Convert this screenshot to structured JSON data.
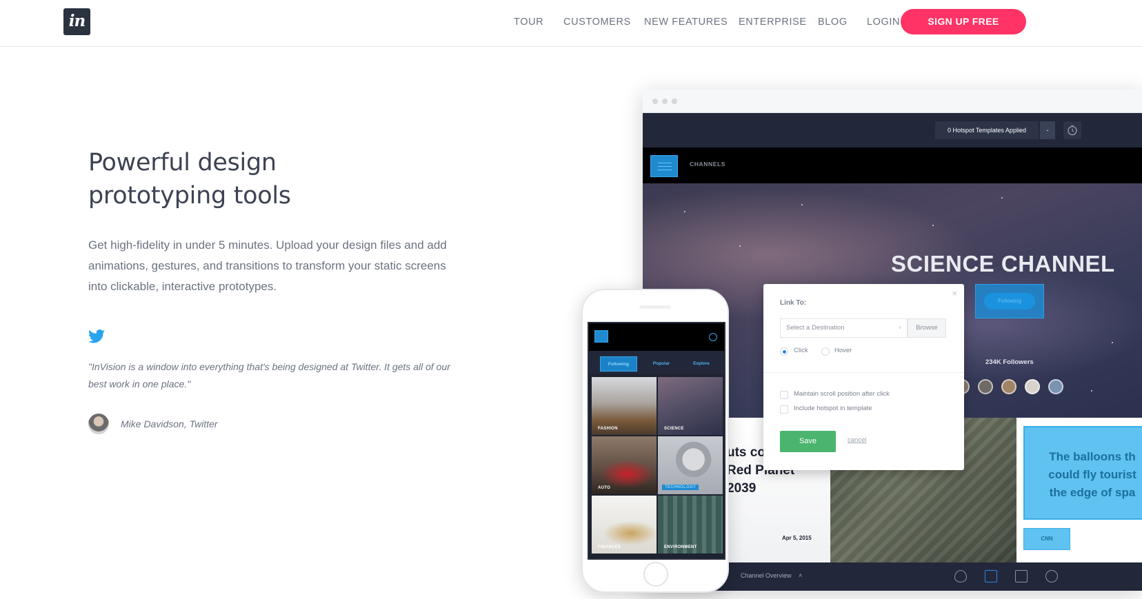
{
  "header": {
    "logo_text": "in",
    "nav": [
      "TOUR",
      "CUSTOMERS",
      "NEW FEATURES",
      "ENTERPRISE",
      "BLOG",
      "LOGIN"
    ],
    "signup_label": "SIGN UP FREE"
  },
  "hero": {
    "title_line1": "Powerful design",
    "title_line2": "prototyping tools",
    "description": "Get high-fidelity in under 5 minutes. Upload your design files and add animations, gestures, and transitions to transform your static screens into clickable, interactive prototypes.",
    "quote": "\"InVision is a window into everything that's being designed at Twitter. It gets all of our best work in one place.\"",
    "author": "Mike Davidson, Twitter"
  },
  "desktop": {
    "templates_label": "0 Hotspot Templates Applied",
    "templates_caret": "-",
    "channels_label": "CHANNELS",
    "science_title": "SCIENCE CHANNEL",
    "following_label": "Following",
    "followers_label": "234K Followers",
    "card_text": "uts co\nRed Planet\n2039",
    "card_date": "Apr 5, 2015",
    "blue_text": "The balloons th\ncould fly tourist\nthe edge of spa",
    "cnn_label": "CNN",
    "channel_overview": "Channel Overview",
    "overview_caret": "˄"
  },
  "modal": {
    "close": "×",
    "title": "Link To:",
    "destination_placeholder": "Select a Destination",
    "destination_caret": "˅",
    "browse_label": "Browse",
    "radio_click": "Click",
    "radio_hover": "Hover",
    "check_scroll": "Maintain scroll position after click",
    "check_hotspot": "Include hotspot in template",
    "save_label": "Save",
    "cancel_label": "cancel"
  },
  "phone": {
    "tabs": [
      "Following",
      "Popular",
      "Explore"
    ],
    "tiles": [
      "FASHION",
      "SCIENCE",
      "AUTO",
      "TECHNOLOGY",
      "FINANCES",
      "ENVIRONMENT"
    ]
  },
  "colors": {
    "accent": "#ff3366",
    "brand_dark": "#2b3240",
    "toolbar": "#22283a",
    "highlight_blue": "#1f8ad0",
    "save_green": "#4bb46f",
    "twitter_blue": "#2aa3ef"
  },
  "icons": [
    "invision-logo",
    "twitter-icon",
    "clock-icon",
    "close-icon",
    "eye-icon",
    "comment-icon",
    "history-icon",
    "search-icon",
    "menu-icon"
  ]
}
